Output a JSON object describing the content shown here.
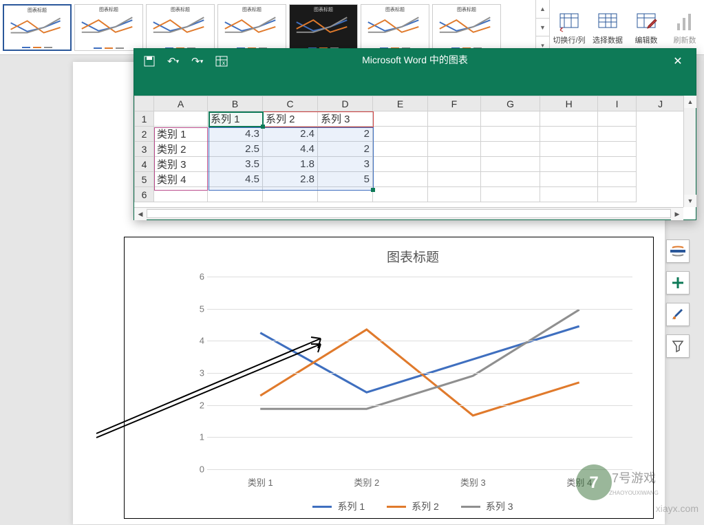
{
  "ribbon": {
    "styles": [
      {
        "name": "style-1",
        "selected": true,
        "title": "图表标题",
        "dark": false
      },
      {
        "name": "style-2",
        "selected": false,
        "title": "图表标题",
        "dark": false
      },
      {
        "name": "style-3",
        "selected": false,
        "title": "图表标题",
        "dark": false
      },
      {
        "name": "style-4",
        "selected": false,
        "title": "图表标题",
        "dark": false
      },
      {
        "name": "style-5",
        "selected": false,
        "title": "图表标题",
        "dark": true
      },
      {
        "name": "style-6",
        "selected": false,
        "title": "图表标题",
        "dark": false
      },
      {
        "name": "style-7",
        "selected": false,
        "title": "图表标题",
        "dark": false
      }
    ],
    "cmds": {
      "switch_row_col": "切换行/列",
      "select_data": "选择数据",
      "edit_data": "编辑数",
      "refresh_data": "刷新数"
    }
  },
  "sheet_window": {
    "title": "Microsoft Word 中的图表",
    "columns": [
      "A",
      "B",
      "C",
      "D",
      "E",
      "F",
      "G",
      "H",
      "I",
      "J"
    ],
    "series_headers": {
      "b": "系列 1",
      "c": "系列 2",
      "d": "系列 3"
    },
    "rows": [
      {
        "idx": "2",
        "a": "类别 1",
        "b": "4.3",
        "c": "2.4",
        "d": "2"
      },
      {
        "idx": "3",
        "a": "类别 2",
        "b": "2.5",
        "c": "4.4",
        "d": "2"
      },
      {
        "idx": "4",
        "a": "类别 3",
        "b": "3.5",
        "c": "1.8",
        "d": "3"
      },
      {
        "idx": "5",
        "a": "类别 4",
        "b": "4.5",
        "c": "2.8",
        "d": "5"
      }
    ],
    "row1_idx": "1",
    "row6_idx": "6"
  },
  "chart": {
    "title": "图表标题",
    "legend": {
      "s1": "系列 1",
      "s2": "系列 2",
      "s3": "系列 3"
    },
    "colors": {
      "s1": "#3f6fbf",
      "s2": "#e07a2c",
      "s3": "#8f8f8f"
    },
    "x": [
      "类别 1",
      "类别 2",
      "类别 3",
      "类别 4"
    ],
    "y_ticks": [
      "0",
      "1",
      "2",
      "3",
      "4",
      "5",
      "6"
    ]
  },
  "chart_data": {
    "type": "line",
    "title": "图表标题",
    "xlabel": "",
    "ylabel": "",
    "ylim": [
      0,
      6
    ],
    "categories": [
      "类别 1",
      "类别 2",
      "类别 3",
      "类别 4"
    ],
    "series": [
      {
        "name": "系列 1",
        "values": [
          4.3,
          2.5,
          3.5,
          4.5
        ],
        "color": "#3f6fbf"
      },
      {
        "name": "系列 2",
        "values": [
          2.4,
          4.4,
          1.8,
          2.8
        ],
        "color": "#e07a2c"
      },
      {
        "name": "系列 3",
        "values": [
          2,
          2,
          3,
          5
        ],
        "color": "#8f8f8f"
      }
    ],
    "legend_position": "bottom",
    "grid": "horizontal"
  },
  "watermark": {
    "site": "xiayx.com",
    "logo_top": "7号游戏",
    "logo_bottom": "ZHAOYOUXIWANG"
  }
}
